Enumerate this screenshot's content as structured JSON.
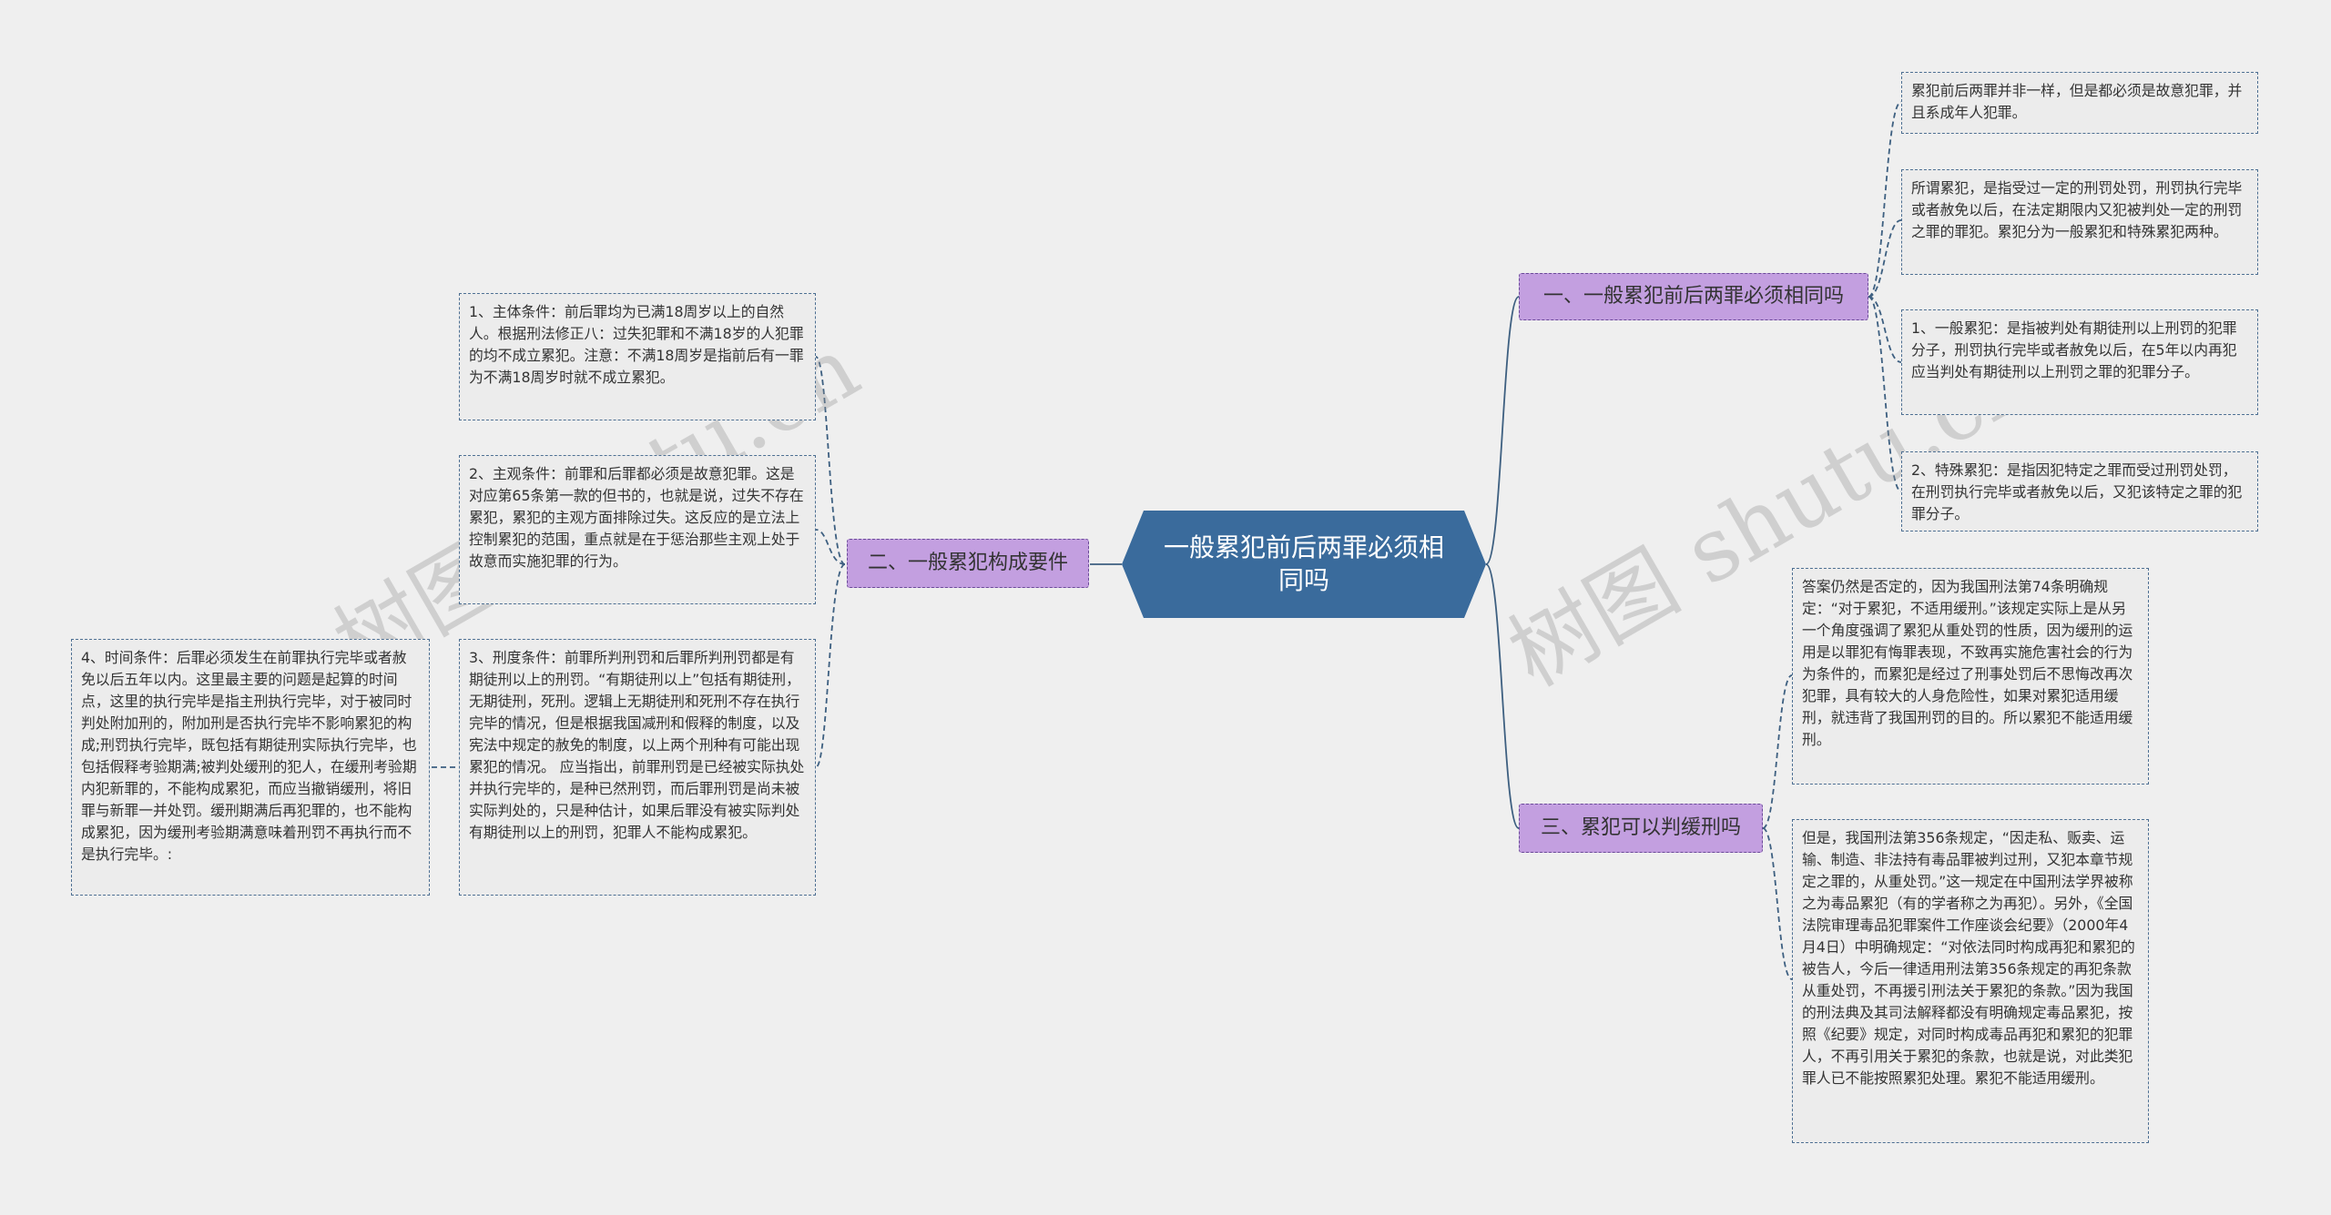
{
  "center": {
    "title": "一般累犯前后两罪必须相同吗"
  },
  "branches": {
    "b1": {
      "label": "一、一般累犯前后两罪必须相同吗"
    },
    "b2": {
      "label": "二、一般累犯构成要件"
    },
    "b3": {
      "label": "三、累犯可以判缓刑吗"
    }
  },
  "leaves": {
    "r1": "累犯前后两罪并非一样，但是都必须是故意犯罪，并且系成年人犯罪。",
    "r2": "所谓累犯，是指受过一定的刑罚处罚，刑罚执行完毕或者赦免以后，在法定期限内又犯被判处一定的刑罚之罪的罪犯。累犯分为一般累犯和特殊累犯两种。",
    "r3": "1、一般累犯：是指被判处有期徒刑以上刑罚的犯罪分子，刑罚执行完毕或者赦免以后，在5年以内再犯应当判处有期徒刑以上刑罚之罪的犯罪分子。",
    "r4": "2、特殊累犯：是指因犯特定之罪而受过刑罚处罚，在刑罚执行完毕或者赦免以后，又犯该特定之罪的犯罪分子。",
    "r5": "答案仍然是否定的，因为我国刑法第74条明确规定：“对于累犯，不适用缓刑。”该规定实际上是从另一个角度强调了累犯从重处罚的性质，因为缓刑的运用是以罪犯有悔罪表现，不致再实施危害社会的行为为条件的，而累犯是经过了刑事处罚后不思悔改再次犯罪，具有较大的人身危险性，如果对累犯适用缓刑，就违背了我国刑罚的目的。所以累犯不能适用缓刑。",
    "r6": "但是，我国刑法第356条规定，“因走私、贩卖、运输、制造、非法持有毒品罪被判过刑，又犯本章节规定之罪的，从重处罚。”这一规定在中国刑法学界被称之为毒品累犯（有的学者称之为再犯）。另外，《全国法院审理毒品犯罪案件工作座谈会纪要》（2000年4月4日）中明确规定：“对依法同时构成再犯和累犯的被告人，今后一律适用刑法第356条规定的再犯条款从重处罚，不再援引刑法关于累犯的条款。”因为我国的刑法典及其司法解释都没有明确规定毒品累犯，按照《纪要》规定，对同时构成毒品再犯和累犯的犯罪人，不再引用关于累犯的条款，也就是说，对此类犯罪人已不能按照累犯处理。累犯不能适用缓刑。",
    "m1": "1、主体条件：前后罪均为已满18周岁以上的自然人。根据刑法修正八：过失犯罪和不满18岁的人犯罪的均不成立累犯。注意：不满18周岁是指前后有一罪为不满18周岁时就不成立累犯。",
    "m2": "2、主观条件：前罪和后罪都必须是故意犯罪。这是对应第65条第一款的但书的，也就是说，过失不存在累犯，累犯的主观方面排除过失。这反应的是立法上控制累犯的范围，重点就是在于惩治那些主观上处于故意而实施犯罪的行为。",
    "m3": "3、刑度条件：前罪所判刑罚和后罪所判刑罚都是有期徒刑以上的刑罚。“有期徒刑以上”包括有期徒刑，无期徒刑，死刑。逻辑上无期徒刑和死刑不存在执行完毕的情况，但是根据我国减刑和假释的制度，以及宪法中规定的赦免的制度，以上两个刑种有可能出现累犯的情况。 应当指出，前罪刑罚是已经被实际执处并执行完毕的，是种已然刑罚，而后罪刑罚是尚未被实际判处的，只是种估计，如果后罪没有被实际判处有期徒刑以上的刑罚，犯罪人不能构成累犯。",
    "m4": "4、时间条件：后罪必须发生在前罪执行完毕或者赦免以后五年以内。这里最主要的问题是起算的时间点，这里的执行完毕是指主刑执行完毕，对于被同时判处附加刑的，附加刑是否执行完毕不影响累犯的构成;刑罚执行完毕，既包括有期徒刑实际执行完毕，也包括假释考验期满;被判处缓刑的犯人，在缓刑考验期内犯新罪的，不能构成累犯，而应当撤销缓刑，将旧罪与新罪一并处罚。缓刑期满后再犯罪的，也不能构成累犯，因为缓刑考验期满意味着刑罚不再执行而不是执行完毕。:"
  },
  "watermarks": [
    "树图 shutu.cn",
    "树图 shutu.cn"
  ],
  "colors": {
    "center": "#3a6b9c",
    "branch": "#c39fe0",
    "branch_border": "#6a4a98",
    "leaf_border": "#4d6f92",
    "background": "#efefef"
  }
}
